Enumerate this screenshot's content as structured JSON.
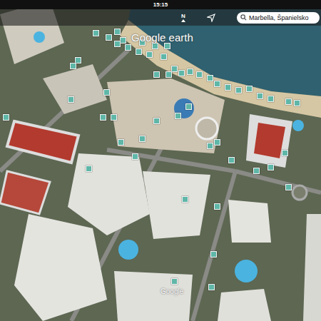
{
  "status_bar": {
    "time": "15:15"
  },
  "toolbar": {
    "compass": "N",
    "search": {
      "value": "Marbella, Španielsko"
    }
  },
  "map": {
    "watermark": "Google earth",
    "attribution": "Google"
  }
}
